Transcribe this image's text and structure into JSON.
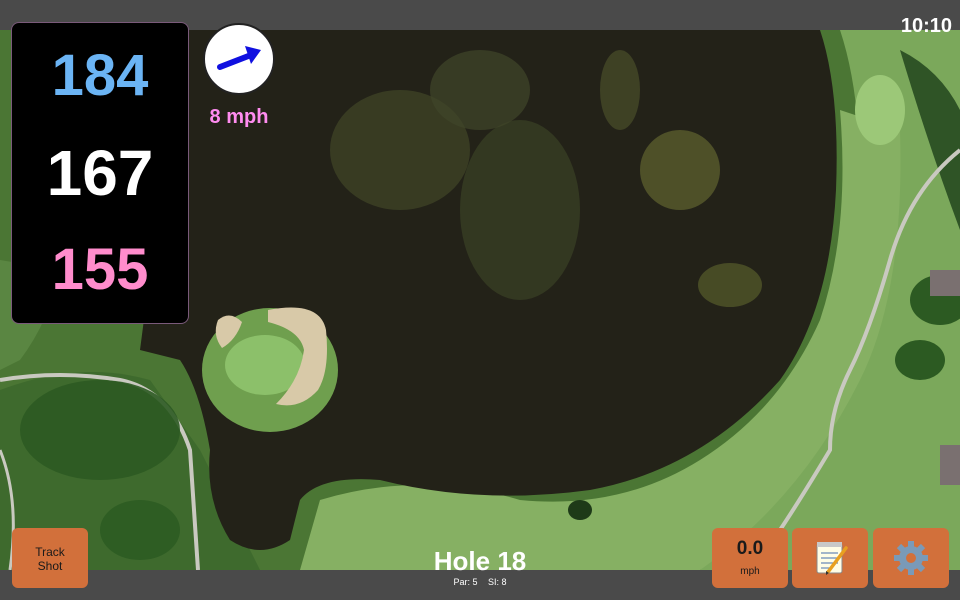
{
  "status_bar": {
    "time": "10:10"
  },
  "distances": {
    "back": "184",
    "middle": "167",
    "front": "155"
  },
  "wind": {
    "speed": "8 mph",
    "arrow_color": "#1010e0",
    "icon": "wind-arrow-icon"
  },
  "hole": {
    "title": "Hole 18",
    "par": "Par: 5",
    "si": "SI: 8"
  },
  "buttons": {
    "track_shot": {
      "line1": "Track",
      "line2": "Shot"
    },
    "shot_speed": {
      "value": "0.0",
      "unit": "mph"
    },
    "notes": {
      "icon": "notepad-icon"
    },
    "settings": {
      "icon": "gear-icon"
    }
  },
  "colors": {
    "button_bg": "#d2703b",
    "back_distance": "#6bb4f4",
    "middle_distance": "#ffffff",
    "front_distance": "#ff8ccc",
    "wind_text": "#ff8cf0",
    "water": "#232218",
    "fairway": "#7aa35a",
    "bunker": "#d8c9a8"
  }
}
